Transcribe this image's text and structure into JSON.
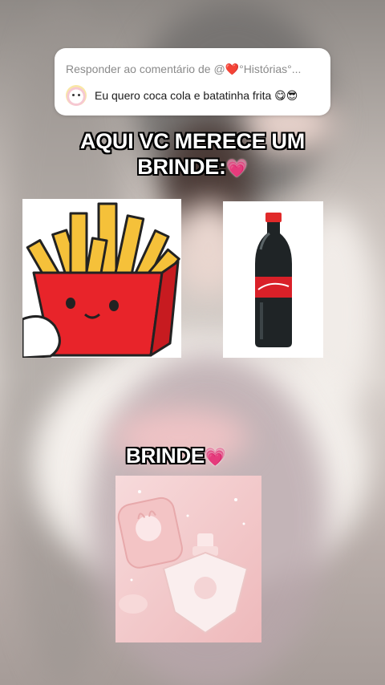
{
  "comment": {
    "reply_to": "Responder ao comentário de @❤️°Histórias°...",
    "text": "Eu quero coca cola e batatinha frita 😋😎"
  },
  "captions": {
    "line1": "AQUI VC MERECE UM",
    "line2": "BRINDE:",
    "brinde": "BRINDE"
  },
  "colors": {
    "heart": "#ff5f85",
    "fries_box": "#e8242a",
    "fries": "#f5c13a"
  }
}
